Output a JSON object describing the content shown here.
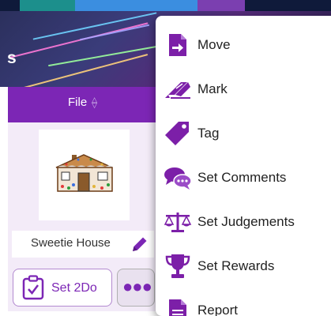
{
  "banner": {
    "letter": "s"
  },
  "header": {
    "sort_label": "File",
    "sort_icon": "sort-updown-icon"
  },
  "card": {
    "name": "Sweetie House",
    "edit_icon": "pencil-icon",
    "thumbnail_icon": "gingerbread-house-image"
  },
  "actions": {
    "set2do_label": "Set 2Do",
    "set2do_icon": "clipboard-check-icon",
    "more_icon": "ellipsis-icon"
  },
  "menu": {
    "items": [
      {
        "label": "Move",
        "icon": "file-move-icon"
      },
      {
        "label": "Mark",
        "icon": "marker-icon"
      },
      {
        "label": "Tag",
        "icon": "tag-icon"
      },
      {
        "label": "Set Comments",
        "icon": "comments-icon"
      },
      {
        "label": "Set Judgements",
        "icon": "scales-icon"
      },
      {
        "label": "Set Rewards",
        "icon": "trophy-icon"
      },
      {
        "label": "Report",
        "icon": "report-icon"
      }
    ]
  },
  "colors": {
    "accent": "#7c26b5",
    "menu_icon": "#7c1fa8",
    "card_bg": "#f3ebf8"
  }
}
